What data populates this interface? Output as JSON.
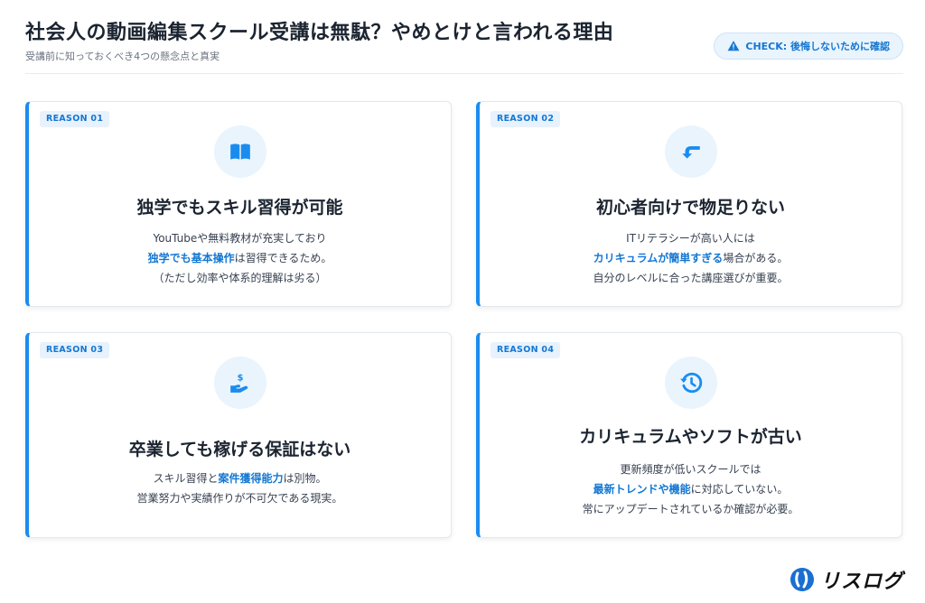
{
  "header": {
    "title": "社会人の動画編集スクール受講は無駄？やめとけと言われる理由",
    "subtitle": "受講前に知っておくべき4つの懸念点と真実",
    "check_badge": "CHECK: 後悔しないために確認"
  },
  "cards": [
    {
      "tag": "REASON 01",
      "icon": "book-icon",
      "title": "独学でもスキル習得が可能",
      "lines": [
        {
          "pre": "YouTubeや無料教材が充実しており",
          "hl": "",
          "post": ""
        },
        {
          "pre": "",
          "hl": "独学でも基本操作",
          "post": "は習得できるため。"
        },
        {
          "pre": "（ただし効率や体系的理解は劣る）",
          "hl": "",
          "post": ""
        }
      ]
    },
    {
      "tag": "REASON 02",
      "icon": "arrow-down-icon",
      "title": "初心者向けで物足りない",
      "lines": [
        {
          "pre": "ITリテラシーが高い人には",
          "hl": "",
          "post": ""
        },
        {
          "pre": "",
          "hl": "カリキュラムが簡単すぎる",
          "post": "場合がある。"
        },
        {
          "pre": "自分のレベルに合った講座選びが重要。",
          "hl": "",
          "post": ""
        }
      ]
    },
    {
      "tag": "REASON 03",
      "icon": "money-hand-icon",
      "title": "卒業しても稼げる保証はない",
      "lines": [
        {
          "pre": "スキル習得と",
          "hl": "案件獲得能力",
          "post": "は別物。"
        },
        {
          "pre": "営業努力や実績作りが不可欠である現実。",
          "hl": "",
          "post": ""
        }
      ]
    },
    {
      "tag": "REASON 04",
      "icon": "history-icon",
      "title": "カリキュラムやソフトが古い",
      "lines": [
        {
          "pre": "更新頻度が低いスクールでは",
          "hl": "",
          "post": ""
        },
        {
          "pre": "",
          "hl": "最新トレンドや機能",
          "post": "に対応していない。"
        },
        {
          "pre": "常にアップデートされているか確認が必要。",
          "hl": "",
          "post": ""
        }
      ]
    }
  ],
  "logo": {
    "text": "リスログ"
  },
  "colors": {
    "accent": "#1a8cf0",
    "accent_text": "#1477d2",
    "icon_bg": "#eaf4fd"
  }
}
